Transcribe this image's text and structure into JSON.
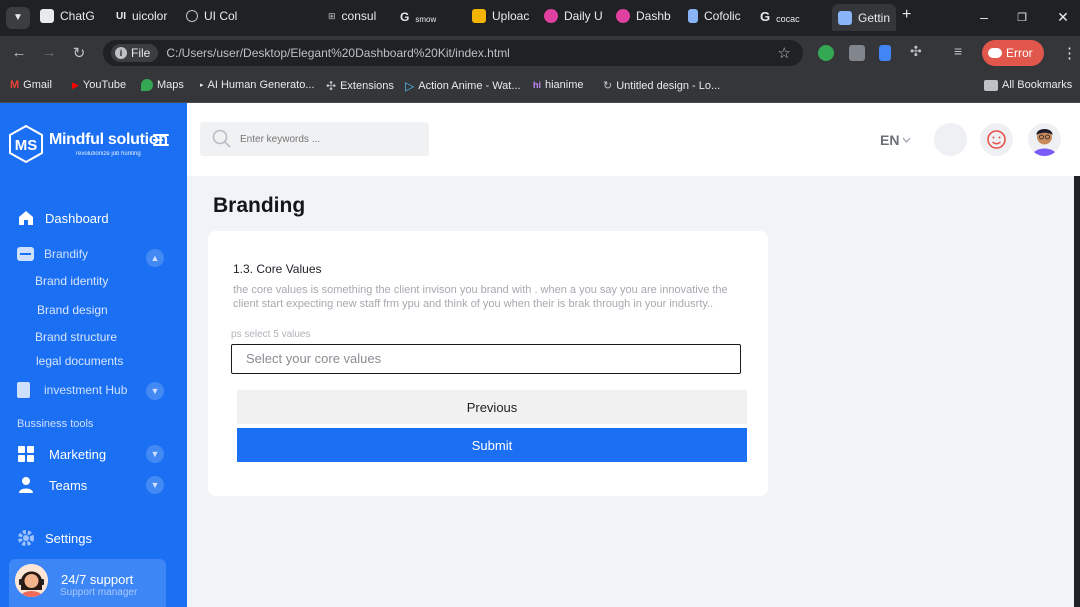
{
  "browser": {
    "tabs": [
      {
        "label": "ChatG",
        "color": "#e8eaed"
      },
      {
        "label": "uicolor",
        "color": "#e8eaed"
      },
      {
        "label": "UI Col",
        "color": "#bdc1c6"
      },
      {
        "label": "consul",
        "color": "#bdc1c6"
      },
      {
        "label": "smow",
        "color": "#bdc1c6"
      },
      {
        "label": "Uploac",
        "color": "#f4b400"
      },
      {
        "label": "Daily U",
        "color": "#e040a0"
      },
      {
        "label": "Dashb",
        "color": "#e040a0"
      },
      {
        "label": "Cofolic",
        "color": "#8ab4f8"
      },
      {
        "label": "cocac",
        "color": "#e8eaed"
      },
      {
        "label": "Gettin",
        "color": "#8ab4f8"
      }
    ],
    "new_tab": "+",
    "window": {
      "minimize": "–",
      "restore": "❐",
      "close": "✕"
    },
    "file_chip": "File",
    "url": "C:/Users/user/Desktop/Elegant%20Dashboard%20Kit/index.html",
    "error_label": "Error",
    "bookmarks": [
      {
        "label": "Gmail"
      },
      {
        "label": "YouTube"
      },
      {
        "label": "Maps"
      },
      {
        "label": "AI Human Generato..."
      },
      {
        "label": "Extensions"
      },
      {
        "label": "Action Anime - Wat..."
      },
      {
        "label": "hianime"
      },
      {
        "label": "Untitled design - Lo..."
      }
    ],
    "all_bookmarks": "All Bookmarks"
  },
  "sidebar": {
    "brand": "Mindful solution",
    "tagline": "revolutionize job hunting",
    "logo_letters": "MS",
    "dashboard": "Dashboard",
    "brandify": "Brandify",
    "brandify_items": [
      "Brand identity",
      "Brand design",
      "Brand structure",
      "legal documents"
    ],
    "investment": "investment Hub",
    "tools_title": "Bussiness tools",
    "marketing": "Marketing",
    "teams": "Teams",
    "settings": "Settings",
    "support_title": "24/7 support",
    "support_sub": "Support manager"
  },
  "header": {
    "search_placeholder": "Enter keywords ...",
    "language": "EN"
  },
  "main": {
    "title": "Branding",
    "question_title": "1.3. Core Values",
    "question_desc": "the core values is something the client invison you brand with . when a you say you are innovative the client start expecting new staff frm ypu and think of you when their is brak through in your indusrty..",
    "hint": "ps select 5 values",
    "select_placeholder": "Select your core values",
    "previous_label": "Previous",
    "submit_label": "Submit"
  },
  "colors": {
    "accent": "#1a6ff2",
    "page_bg": "#f1f3f8",
    "error": "#e2574c"
  }
}
